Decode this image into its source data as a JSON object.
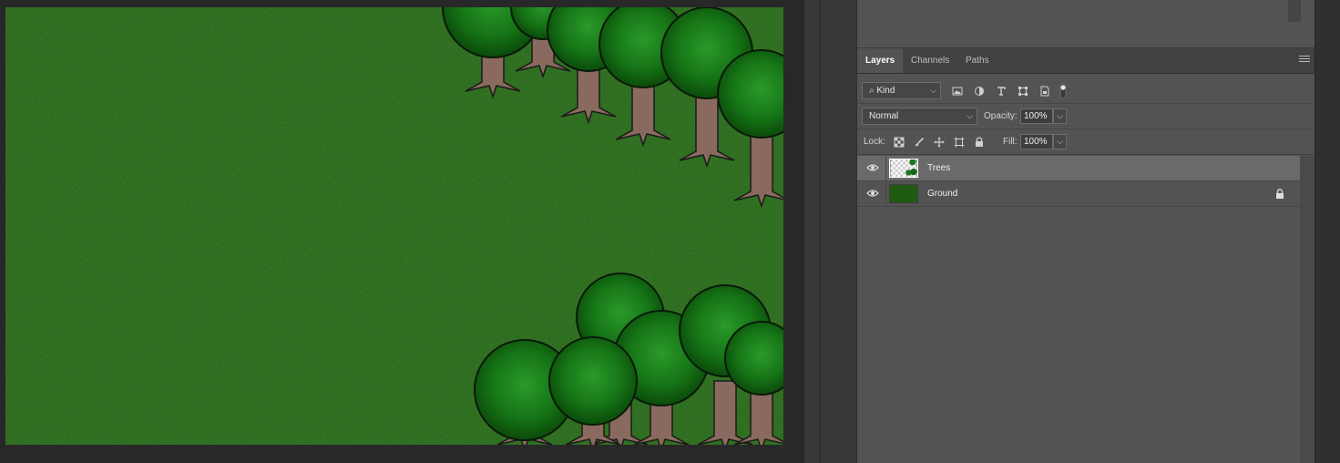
{
  "document": {
    "canvas_icon": "forest-scene-canvas",
    "colors": {
      "grass": "#1e5a10",
      "canopy": "#1c7a1c",
      "trunk": "#8a6a5e"
    }
  },
  "layers_panel": {
    "tabs": [
      {
        "label": "Layers",
        "active": true
      },
      {
        "label": "Channels",
        "active": false
      },
      {
        "label": "Paths",
        "active": false
      }
    ],
    "filter": {
      "kind_label": "Kind",
      "icons": [
        "image-filter-icon",
        "adjustment-filter-icon",
        "type-filter-icon",
        "shape-filter-icon",
        "smart-object-filter-icon",
        "filter-toggle-icon"
      ]
    },
    "blend_mode": "Normal",
    "opacity_label": "Opacity:",
    "opacity_value": "100%",
    "lock_label": "Lock:",
    "lock_icons": [
      "lock-transparent-icon",
      "lock-image-icon",
      "lock-position-icon",
      "lock-artboard-icon",
      "lock-all-icon"
    ],
    "fill_label": "Fill:",
    "fill_value": "100%",
    "layers": [
      {
        "name": "Trees",
        "visible": true,
        "selected": true,
        "locked": false,
        "thumb_icon": "trees-thumbnail"
      },
      {
        "name": "Ground",
        "visible": true,
        "selected": false,
        "locked": true,
        "thumb_icon": "ground-thumbnail"
      }
    ]
  }
}
